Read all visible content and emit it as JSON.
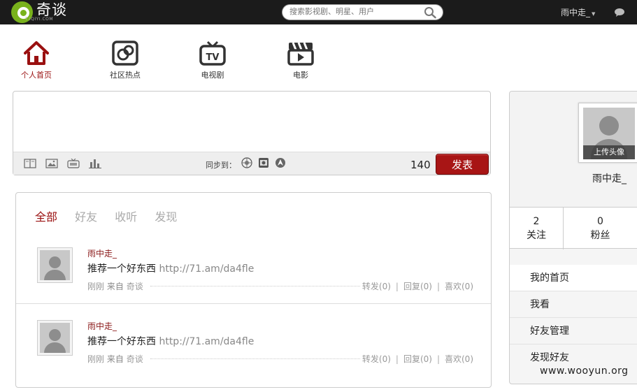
{
  "topbar": {
    "logo_text": "奇谈",
    "logo_sub": "T.IQIYI.COM",
    "search_placeholder": "搜索影视剧、明星、用户",
    "username": "雨中走_"
  },
  "nav": [
    {
      "label": "个人首页",
      "icon": "home-icon",
      "active": true
    },
    {
      "label": "社区热点",
      "icon": "community-icon",
      "active": false
    },
    {
      "label": "电视剧",
      "icon": "tv-icon",
      "active": false
    },
    {
      "label": "电影",
      "icon": "clapperboard-icon",
      "active": false
    }
  ],
  "composer": {
    "sync_label": "同步到：",
    "counter": "140",
    "publish_label": "发表"
  },
  "feed": {
    "tabs": [
      "全部",
      "好友",
      "收听",
      "发现"
    ],
    "posts": [
      {
        "author": "雨中走_",
        "text": "推荐一个好东西",
        "link": "http://71.am/da4fle",
        "time": "刚刚",
        "source_prefix": "来自",
        "source": "奇谈",
        "repost": "转发(0)",
        "reply": "回复(0)",
        "like": "喜欢(0)"
      },
      {
        "author": "雨中走_",
        "text": "推荐一个好东西",
        "link": "http://71.am/da4fle",
        "time": "刚刚",
        "source_prefix": "来自",
        "source": "奇谈",
        "repost": "转发(0)",
        "reply": "回复(0)",
        "like": "喜欢(0)"
      }
    ],
    "action_separator": "|"
  },
  "profile": {
    "upload_label": "上传头像",
    "name": "雨中走_",
    "following_count": "2",
    "following_label": "关注",
    "followers_count": "0",
    "followers_label": "粉丝"
  },
  "side_menu": [
    "我的首页",
    "我看",
    "好友管理",
    "发现好友"
  ],
  "watermark": "www.wooyun.org",
  "colors": {
    "accent": "#9a1010",
    "button": "#a81515",
    "logo_green": "#79b21c",
    "topbar": "#1b1b1b"
  }
}
